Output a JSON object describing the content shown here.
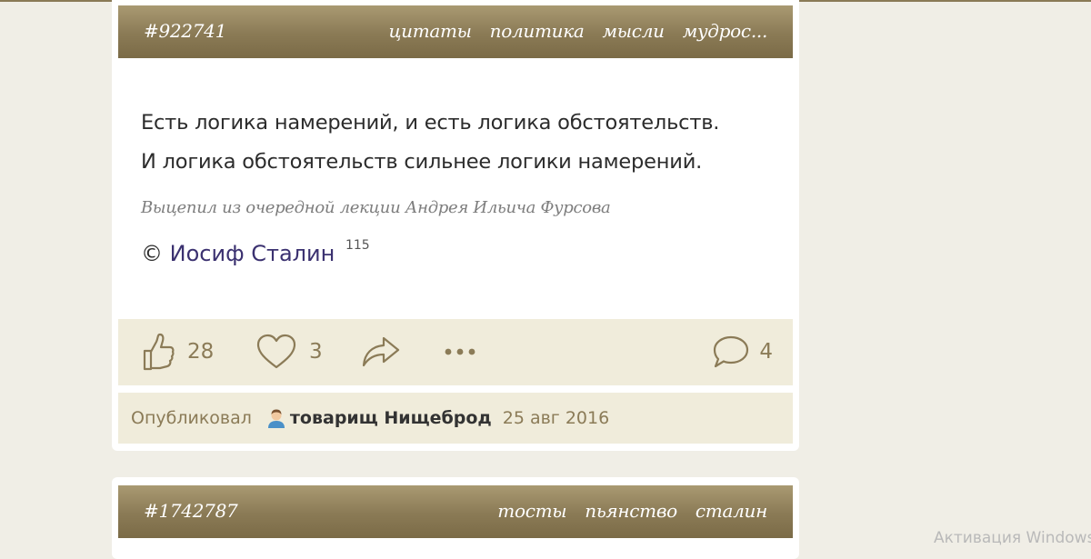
{
  "quotes": [
    {
      "id": "#922741",
      "tags": [
        "цитаты",
        "политика",
        "мысли",
        "мудрос..."
      ],
      "text_lines": [
        "Есть логика намерений, и есть логика обстоятельств.",
        "И логика обстоятельств сильнее логики намерений."
      ],
      "note": "Выцепил из очередной лекции Андрея Ильича Фурсова",
      "copyright": "©",
      "author": "Иосиф Сталин",
      "author_count": "115",
      "likes": "28",
      "favorites": "3",
      "comments": "4",
      "published_label": "Опубликовал",
      "publisher": "товарищ Нищеброд",
      "date": "25 авг 2016"
    },
    {
      "id": "#1742787",
      "tags": [
        "тосты",
        "пьянство",
        "сталин"
      ]
    }
  ],
  "watermark": "Активация Windows",
  "colors": {
    "header_gradient_top": "#a99a72",
    "header_gradient_bottom": "#7b6b47",
    "panel_bg": "#f0ecdb",
    "page_bg": "#f0eee6",
    "accent": "#8b7b57",
    "author_link": "#3b3170"
  },
  "icons": {
    "like": "thumbs-up-icon",
    "favorite": "heart-icon",
    "share": "share-arrow-icon",
    "more": "more-dots-icon",
    "comments": "comment-bubble-icon",
    "user": "user-avatar-icon"
  }
}
